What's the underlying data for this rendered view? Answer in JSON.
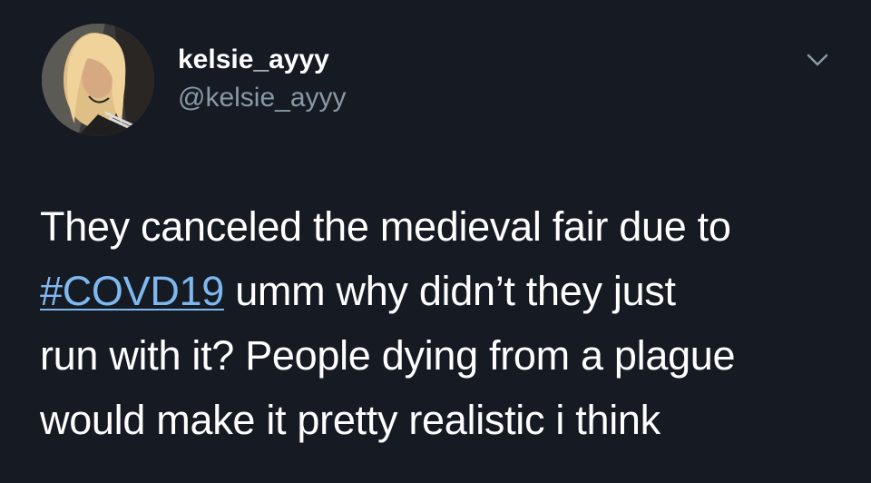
{
  "tweet": {
    "author": {
      "display_name": "kelsie_ayyy",
      "handle": "@kelsie_ayyy",
      "avatar_icon": "profile-photo"
    },
    "menu_icon": "chevron-down-icon",
    "text": {
      "line1": "They canceled the medieval fair due to",
      "hashtag": "#COVD19",
      "line2_rest": " umm why didn’t they just",
      "line3": "run with it? People dying from a plague",
      "line4": "would make it pretty realistic i think"
    }
  },
  "colors": {
    "background": "#151a23",
    "text": "#ffffff",
    "handle": "#8899a6",
    "hashtag": "#7fb8ef"
  }
}
